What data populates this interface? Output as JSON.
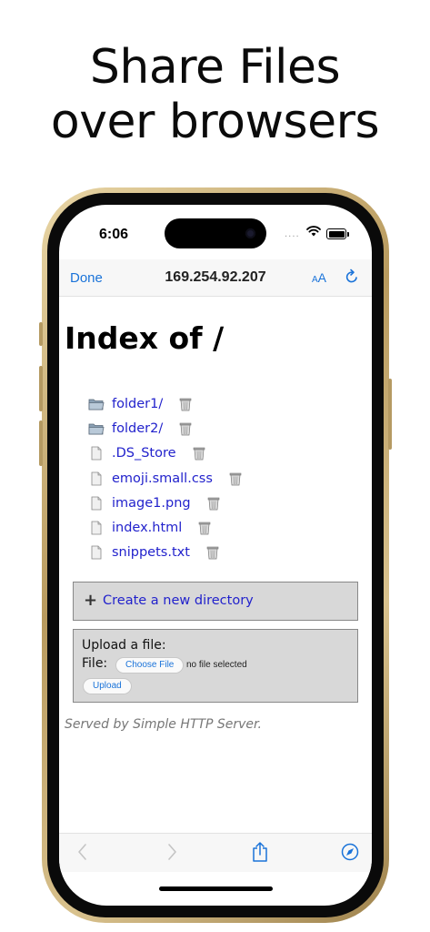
{
  "headline": {
    "line1": "Share Files",
    "line2": "over browsers"
  },
  "status_bar": {
    "time": "6:06",
    "cellular": "····"
  },
  "browser": {
    "done_label": "Done",
    "url": "169.254.92.207",
    "aa_big": "A",
    "aa_small": "A",
    "reload_icon": "reload-icon"
  },
  "page": {
    "title": "Index of /",
    "files": [
      {
        "name": "folder1/",
        "type": "folder"
      },
      {
        "name": "folder2/",
        "type": "folder"
      },
      {
        "name": ".DS_Store",
        "type": "file"
      },
      {
        "name": "emoji.small.css",
        "type": "file"
      },
      {
        "name": "image1.png",
        "type": "file"
      },
      {
        "name": "index.html",
        "type": "file"
      },
      {
        "name": "snippets.txt",
        "type": "file"
      }
    ],
    "create_dir_label": "Create a new directory",
    "upload": {
      "title": "Upload a file:",
      "file_label": "File:",
      "choose_label": "Choose File",
      "no_file": "no file selected",
      "upload_label": "Upload"
    },
    "footer": "Served by Simple HTTP Server."
  },
  "toolbar": {
    "icons": [
      "back-icon",
      "forward-icon",
      "share-icon",
      "compass-icon"
    ]
  },
  "colors": {
    "link": "#2222cc",
    "ios_blue": "#1a73d9",
    "frame_gold": "#c9ad74"
  }
}
